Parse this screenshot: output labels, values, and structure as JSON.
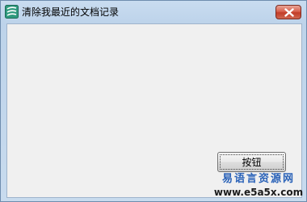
{
  "window": {
    "title": "清除我最近的文档记录",
    "close_icon": "close-icon"
  },
  "button": {
    "label": "按钮"
  },
  "watermark": {
    "site_name": "易语言资源网",
    "url": "www.e5a5x.com"
  },
  "colors": {
    "close_button": "#c8412c",
    "client_background": "#f0f0f0",
    "frame": "#bdd3ea",
    "watermark_text": "#2a62b8"
  }
}
